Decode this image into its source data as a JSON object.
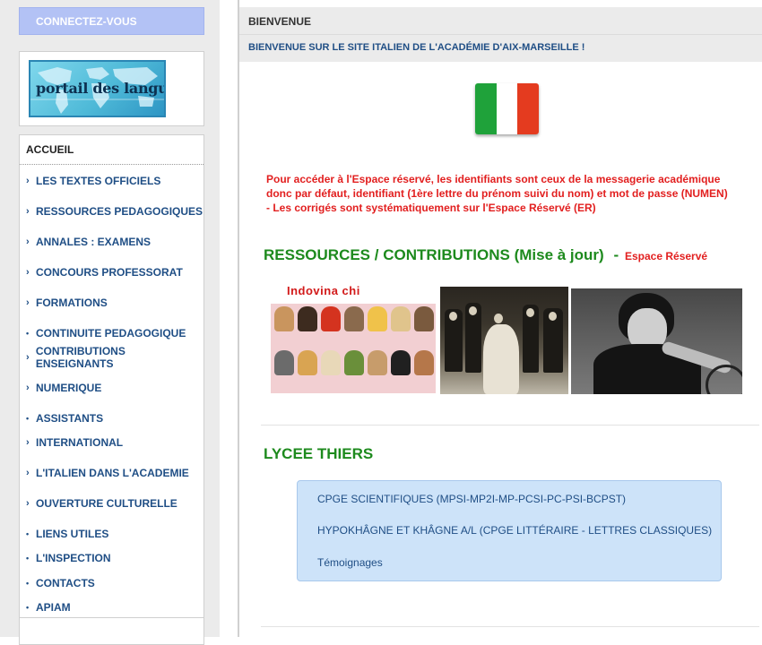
{
  "login_button": "CONNECTEZ-VOUS",
  "logo": {
    "text": "portail des langues",
    "icon": "world-map-logo"
  },
  "nav": {
    "heading": "ACCUEIL",
    "items": [
      {
        "label": "LES TEXTES OFFICIELS",
        "marker": "arrow"
      },
      {
        "label": "RESSOURCES PEDAGOGIQUES",
        "marker": "arrow"
      },
      {
        "label": "ANNALES : EXAMENS",
        "marker": "arrow"
      },
      {
        "label": "CONCOURS PROFESSORAT",
        "marker": "arrow"
      },
      {
        "label": "FORMATIONS",
        "marker": "arrow"
      },
      {
        "label": "CONTINUITE PEDAGOGIQUE",
        "marker": "dot"
      },
      {
        "label": "CONTRIBUTIONS ENSEIGNANTS",
        "marker": "arrow"
      },
      {
        "label": "NUMERIQUE",
        "marker": "arrow"
      },
      {
        "label": "ASSISTANTS",
        "marker": "dot"
      },
      {
        "label": "INTERNATIONAL",
        "marker": "arrow"
      },
      {
        "label": "L'ITALIEN DANS L'ACADEMIE",
        "marker": "arrow"
      },
      {
        "label": "OUVERTURE CULTURELLE",
        "marker": "arrow"
      },
      {
        "label": "LIENS UTILES",
        "marker": "dot"
      },
      {
        "label": "L'INSPECTION",
        "marker": "dot"
      },
      {
        "label": "CONTACTS",
        "marker": "dot"
      },
      {
        "label": "APIAM",
        "marker": "dot"
      }
    ]
  },
  "header": {
    "title": "BIENVENUE",
    "subtitle": "BIENVENUE SUR LE SITE ITALIEN DE L'ACADÉMIE D'AIX-MARSEILLE !"
  },
  "flag": {
    "icon": "italian-flag",
    "colors": [
      "#1fa23a",
      "#ffffff",
      "#e43b1f"
    ]
  },
  "notice": {
    "line1": "Pour accéder à l'Espace réservé, les identifiants sont ceux de la messagerie académique",
    "line2": "donc par défaut, identifiant (1ère lettre du prénom suivi du nom) et mot de passe (NUMEN)",
    "line3": "- Les corrigés sont systématiquement sur l'Espace Réservé (ER)"
  },
  "ressources": {
    "title": "RESSOURCES / CONTRIBUTIONS (Mise à jour)",
    "dash": "-",
    "reserve_link": "Espace Réservé",
    "images": [
      {
        "title": "Indovina chi",
        "icon": "indovina-chi-faces-image"
      },
      {
        "icon": "wedding-photo-image"
      },
      {
        "icon": "cyclist-woman-photo-image"
      }
    ]
  },
  "lycee": {
    "title": "LYCEE THIERS",
    "links": [
      "CPGE SCIENTIFIQUES (MPSI-MP2I-MP-PCSI-PC-PSI-BCPST)",
      "HYPOKHÂGNE ET KHÂGNE A/L (CPGE LITTÉRAIRE - LETTRES CLASSIQUES)",
      "Témoignages"
    ]
  },
  "colors": {
    "link_blue": "#1f4e85",
    "notice_red": "#e21f1f",
    "title_green": "#1d8a1d",
    "login_bg": "#b3c2f5",
    "box_blue": "#cde3f9"
  }
}
